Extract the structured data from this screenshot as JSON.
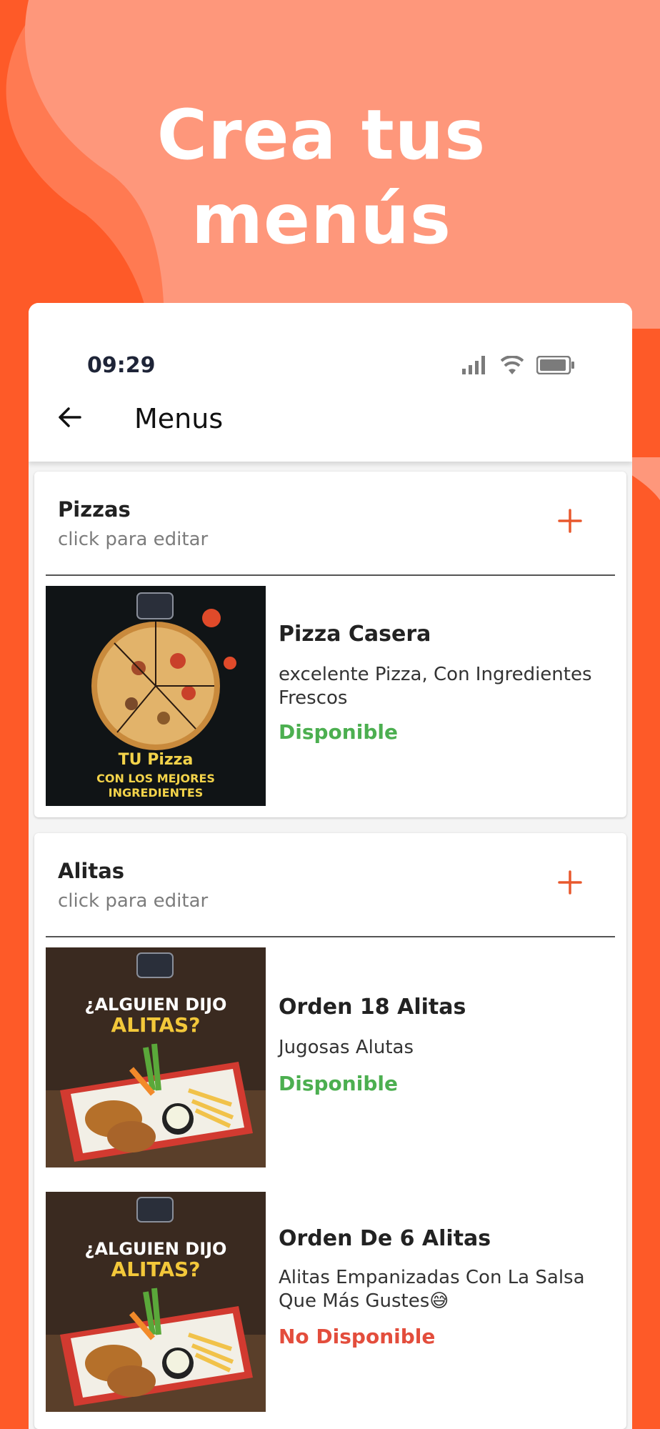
{
  "headline": {
    "line1": "Crea tus",
    "line2": "menús"
  },
  "status_bar": {
    "time": "09:29",
    "icons": [
      "signal-icon",
      "wifi-icon",
      "battery-icon"
    ]
  },
  "app_bar": {
    "title": "Menus",
    "back_icon": "arrow-left-icon"
  },
  "colors": {
    "orange": "#fe5a28",
    "salmon": "#fe977b",
    "available": "#4caf50",
    "unavailable": "#e34d3c",
    "accent_plus": "#e8582d"
  },
  "sections": [
    {
      "title": "Pizzas",
      "subtitle": "click para editar",
      "items": [
        {
          "name": "Pizza Casera",
          "description": "excelente Pizza, Con Ingredientes Frescos",
          "status": "Disponible",
          "thumb_text": [
            "TU Pizza",
            "CON LOS MEJORES",
            "INGREDIENTES"
          ]
        }
      ]
    },
    {
      "title": "Alitas",
      "subtitle": "click para editar",
      "items": [
        {
          "name": "Orden 18 Alitas",
          "description": "Jugosas Alutas",
          "status": "Disponible",
          "thumb_text": [
            "¿ALGUIEN DIJO",
            "ALITAS?"
          ]
        },
        {
          "name": "Orden De 6 Alitas",
          "description": "Alitas Empanizadas Con La Salsa Que Más Gustes😅",
          "status": "No Disponible",
          "thumb_text": [
            "¿ALGUIEN DIJO",
            "ALITAS?"
          ]
        }
      ]
    }
  ]
}
